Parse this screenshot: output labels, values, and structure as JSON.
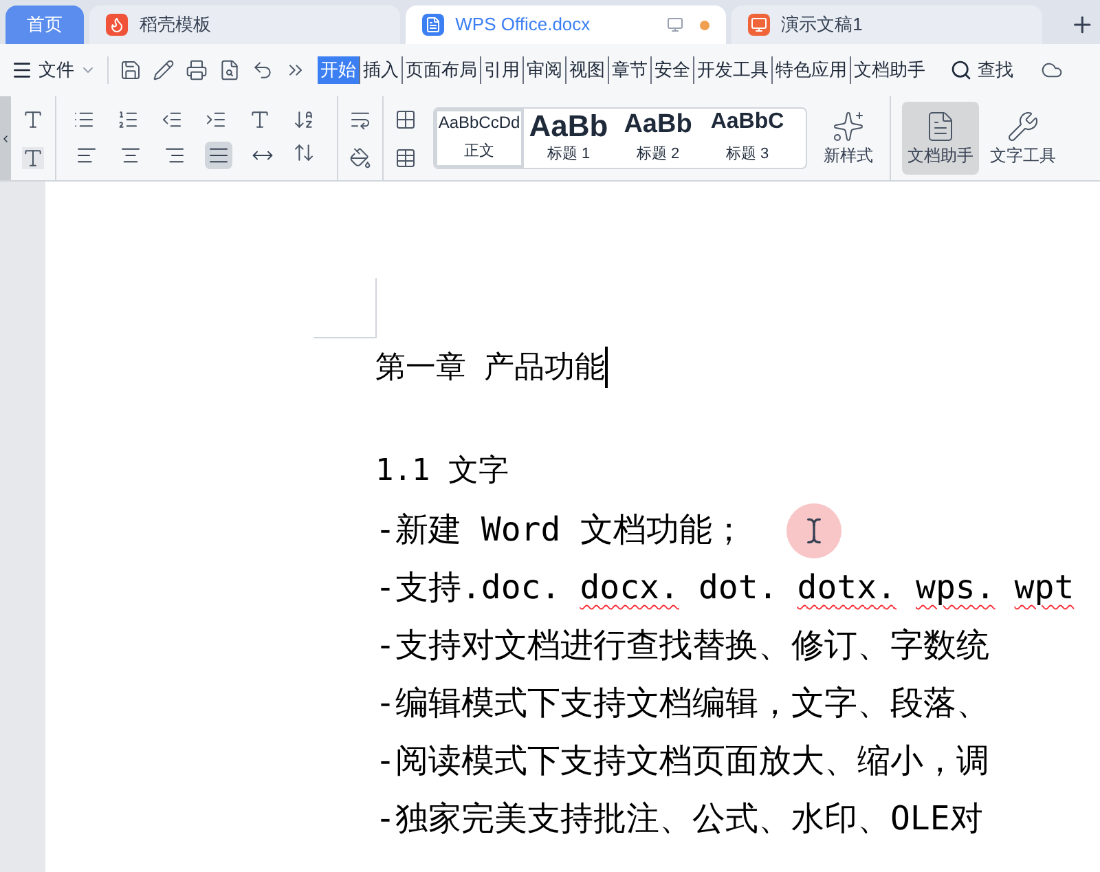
{
  "tabs": [
    {
      "label": "首页",
      "kind": "home",
      "selected": false
    },
    {
      "label": "稻壳模板",
      "kind": "docer",
      "selected": false
    },
    {
      "label": "WPS Office.docx",
      "kind": "writer",
      "selected": true,
      "unsaved": true
    },
    {
      "label": "演示文稿1",
      "kind": "presentation",
      "selected": false
    }
  ],
  "menu": {
    "file": "文件",
    "ribbon_tabs": [
      {
        "label": "开始",
        "selected": true
      },
      {
        "label": "插入",
        "selected": false
      },
      {
        "label": "页面布局",
        "selected": false
      },
      {
        "label": "引用",
        "selected": false
      },
      {
        "label": "审阅",
        "selected": false
      },
      {
        "label": "视图",
        "selected": false
      },
      {
        "label": "章节",
        "selected": false
      },
      {
        "label": "安全",
        "selected": false
      },
      {
        "label": "开发工具",
        "selected": false
      },
      {
        "label": "特色应用",
        "selected": false
      },
      {
        "label": "文档助手",
        "selected": false
      }
    ],
    "search": "查找"
  },
  "toolbar": {
    "alignment": [
      {
        "kind": "left",
        "selected": false
      },
      {
        "kind": "center",
        "selected": false
      },
      {
        "kind": "right",
        "selected": false
      },
      {
        "kind": "justify",
        "selected": true
      },
      {
        "kind": "distribute",
        "selected": false
      }
    ],
    "styles": [
      {
        "sample": "AaBbCcDd",
        "name": "正文",
        "kind": "body"
      },
      {
        "sample": "AaBb",
        "name": "标题 1",
        "kind": "h1"
      },
      {
        "sample": "AaBb",
        "name": "标题 2",
        "kind": "h2"
      },
      {
        "sample": "AaBbC",
        "name": "标题 3",
        "kind": "h3"
      }
    ],
    "new_style": "新样式",
    "doc_assistant": {
      "label": "文档助手",
      "selected": true
    },
    "text_tools": "文字工具"
  },
  "document": {
    "heading": "第一章 产品功能",
    "subheading": "1.1 文字",
    "lines": [
      {
        "segments": [
          {
            "text": "-新建 Word 文档功能；",
            "misspelled": false
          }
        ]
      },
      {
        "segments": [
          {
            "text": "-支持.doc.",
            "misspelled": false
          },
          {
            "text": "docx.",
            "misspelled": true
          },
          {
            "text": "dot.",
            "misspelled": false
          },
          {
            "text": "dotx.",
            "misspelled": true
          },
          {
            "text": "wps.",
            "misspelled": true
          },
          {
            "text": "wpt",
            "misspelled": true
          }
        ]
      },
      {
        "segments": [
          {
            "text": "-支持对文档进行查找替换、修订、字数统",
            "misspelled": false
          }
        ]
      },
      {
        "segments": [
          {
            "text": "-编辑模式下支持文档编辑，文字、段落、",
            "misspelled": false
          }
        ]
      },
      {
        "segments": [
          {
            "text": "-阅读模式下支持文档页面放大、缩小，调",
            "misspelled": false
          }
        ]
      },
      {
        "segments": [
          {
            "text": "-独家完美支持批注、公式、水印、OLE对",
            "misspelled": false
          }
        ]
      }
    ]
  }
}
